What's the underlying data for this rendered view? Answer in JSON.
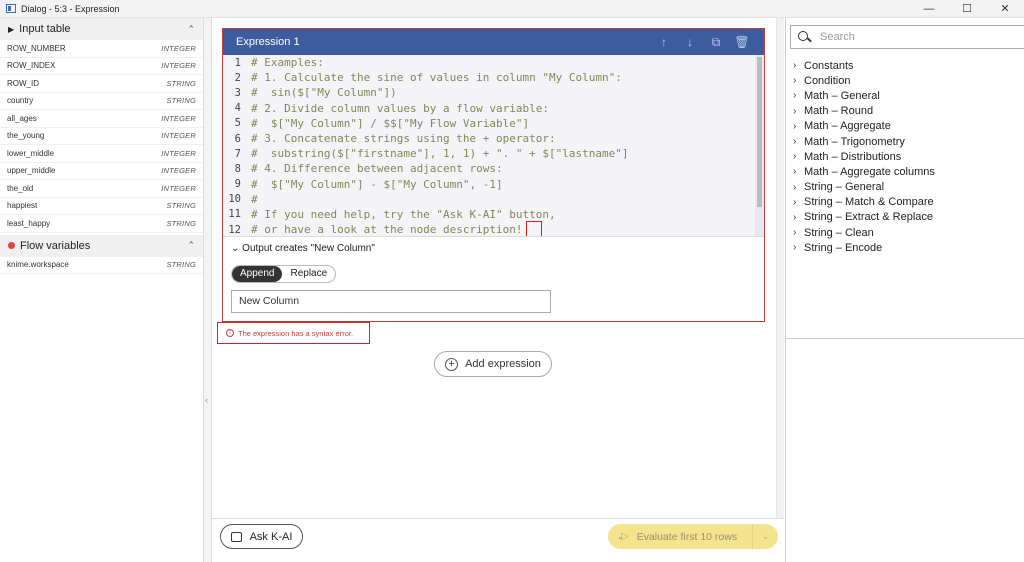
{
  "window": {
    "title": "Dialog - 5:3 - Expression",
    "controls": [
      "—",
      "☐",
      "✕"
    ]
  },
  "input_table": {
    "title": "Input table",
    "columns": [
      {
        "name": "ROW_NUMBER",
        "type": "INTEGER"
      },
      {
        "name": "ROW_INDEX",
        "type": "INTEGER"
      },
      {
        "name": "ROW_ID",
        "type": "STRING"
      },
      {
        "name": "country",
        "type": "STRING"
      },
      {
        "name": "all_ages",
        "type": "INTEGER"
      },
      {
        "name": "the_young",
        "type": "INTEGER"
      },
      {
        "name": "lower_middle",
        "type": "INTEGER"
      },
      {
        "name": "upper_middle",
        "type": "INTEGER"
      },
      {
        "name": "the_old",
        "type": "INTEGER"
      },
      {
        "name": "happiest",
        "type": "STRING"
      },
      {
        "name": "least_happy",
        "type": "STRING"
      }
    ]
  },
  "flow_variables": {
    "title": "Flow variables",
    "items": [
      {
        "name": "knime.workspace",
        "type": "STRING"
      }
    ]
  },
  "expression": {
    "title": "Expression 1",
    "lines": [
      "# Examples:",
      "# 1. Calculate the sine of values in column \"My Column\":",
      "#  sin($[\"My Column\"])",
      "# 2. Divide column values by a flow variable:",
      "#  $[\"My Column\"] / $$[\"My Flow Variable\"]",
      "# 3. Concatenate strings using the + operator:",
      "#  substring($[\"firstname\"], 1, 1) + \". \" + $[\"lastname\"]",
      "# 4. Difference between adjacent rows:",
      "#  $[\"My Column\"] - $[\"My Column\", -1]",
      "#",
      "# If you need help, try the \"Ask K-AI\" button,",
      "# or have a look at the node description!"
    ],
    "output_title": "Output creates \"New Column\"",
    "append_label": "Append",
    "replace_label": "Replace",
    "column_name": "New Column",
    "error": "The expression has a syntax error."
  },
  "add_expression_label": "Add expression",
  "ask_label": "Ask K-AI",
  "evaluate_label": "Evaluate first 10 rows",
  "search": {
    "placeholder": "Search"
  },
  "categories": [
    "Constants",
    "Condition",
    "Math – General",
    "Math – Round",
    "Math – Aggregate",
    "Math – Trigonometry",
    "Math – Distributions",
    "Math – Aggregate columns",
    "String – General",
    "String – Match & Compare",
    "String – Extract & Replace",
    "String – Clean",
    "String – Encode"
  ],
  "colors": {
    "header": "#3d5c9e",
    "error": "#c43d3d",
    "evaluate": "#f5e48e",
    "code": "#7c8a55"
  }
}
